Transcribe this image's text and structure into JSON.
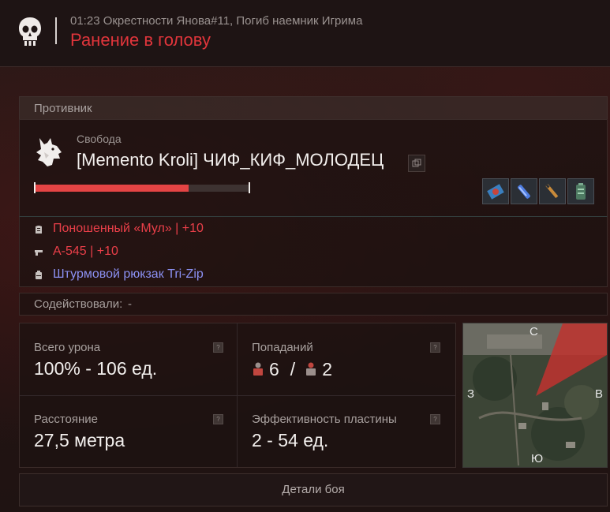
{
  "header": {
    "subtitle": "01:23 Окрестности Янова#11, Погиб наемник Игрима",
    "title": "Ранение в голову"
  },
  "enemy": {
    "section_label": "Противник",
    "faction": "Свобода",
    "player_name": "[Memento Kroli] ЧИФ_КИФ_МОЛОДЕЦ",
    "health_fraction": 0.72,
    "slot_icons": [
      "anomaly-artifact-icon",
      "blue-ampoule-icon",
      "syringe-icon",
      "battery-icon"
    ]
  },
  "equipment": {
    "armor": "Поношенный «Мул» | +10",
    "weapon": "А-545 | +10",
    "backpack": "Штурмовой рюкзак Tri-Zip"
  },
  "assist": {
    "label": "Содействовали:",
    "value": "-"
  },
  "stats": {
    "damage": {
      "label": "Всего урона",
      "value": "100% - 106 ед."
    },
    "hits": {
      "label": "Попаданий",
      "body": "6",
      "sep": "/",
      "head": "2"
    },
    "distance": {
      "label": "Расстояние",
      "value": "27,5 метра"
    },
    "plate": {
      "label": "Эффективность пластины",
      "value": "2 - 54 ед."
    },
    "help_glyph": "?"
  },
  "map": {
    "north": "С",
    "south": "Ю",
    "west": "З",
    "east": "В"
  },
  "details_button": "Детали боя",
  "colors": {
    "accent_red": "#e0353b",
    "item_red": "#ea3f49",
    "item_blue": "#8b90f2",
    "health_red": "#e44444"
  }
}
